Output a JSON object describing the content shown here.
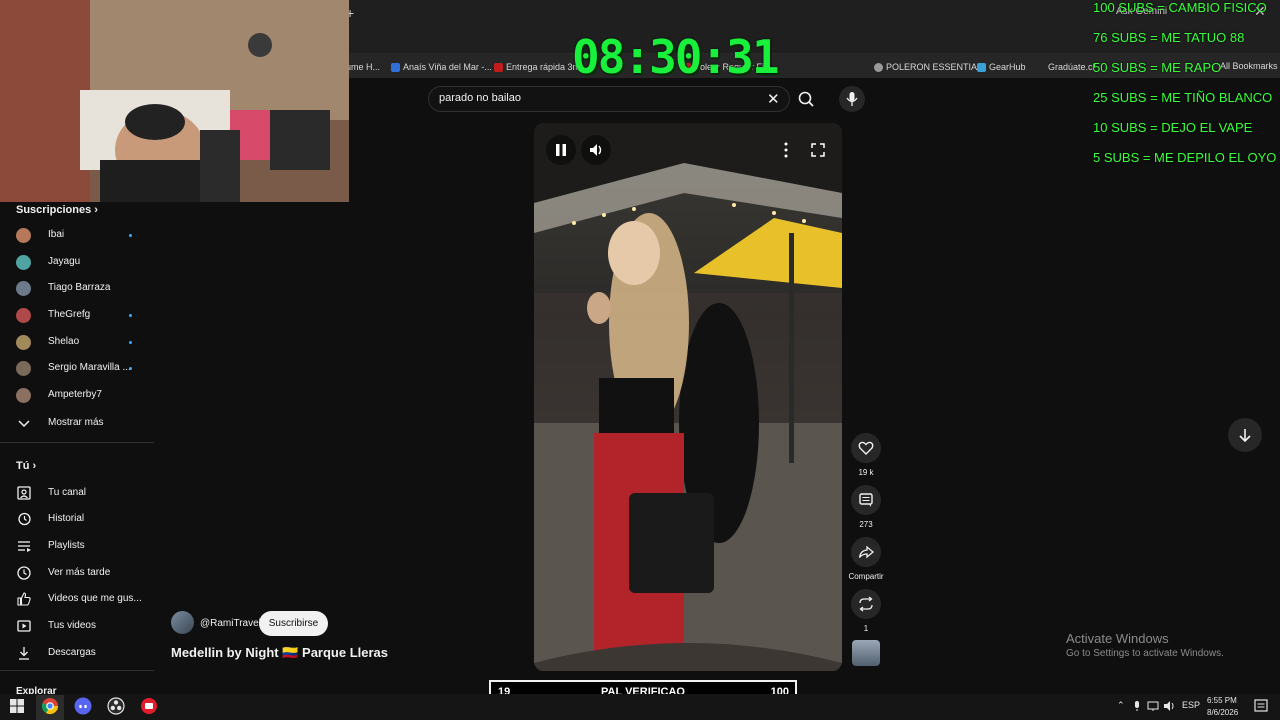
{
  "browser": {
    "ask_gemini": "Ask Gemini",
    "new_tab_glyph": "+",
    "close_glyph": "✕",
    "bookmarks": [
      {
        "label": "ume H...",
        "color": "#1f1f1f"
      },
      {
        "label": "Anaís Viña del Mar -...",
        "color": "#2f6fd6"
      },
      {
        "label": "Entrega rápida 3mi",
        "color": "#c21d1d"
      },
      {
        "label": "Polera Regular Fit -...",
        "color": "#c21d1d"
      },
      {
        "label": "POLERON ESSENTIA...",
        "color": "#9a9a9a"
      },
      {
        "label": "GearHub",
        "color": "#3aa0d8"
      },
      {
        "label": "Gradúate.cl",
        "color": "#1f1f1f"
      }
    ],
    "all_bookmarks": "All Bookmarks"
  },
  "search": {
    "query": "parado no bailao"
  },
  "sidebar": {
    "subscriptions_heading": "Suscripciones",
    "subscriptions": [
      {
        "name": "Ibai",
        "dot": true,
        "color": "#b5785a"
      },
      {
        "name": "Jayagu",
        "dot": false,
        "color": "#4fa3a0"
      },
      {
        "name": "Tiago Barraza",
        "dot": false,
        "color": "#6c7a8a"
      },
      {
        "name": "TheGrefg",
        "dot": true,
        "color": "#b04a4a"
      },
      {
        "name": "Shelao",
        "dot": true,
        "color": "#a08a5a"
      },
      {
        "name": "Sergio Maravilla ...",
        "dot": true,
        "color": "#7a6a5a"
      },
      {
        "name": "Ampeterby7",
        "dot": false,
        "color": "#8a7060"
      }
    ],
    "show_more": "Mostrar más",
    "you_heading": "Tú",
    "you_items": [
      {
        "label": "Tu canal",
        "icon": "channel-icon"
      },
      {
        "label": "Historial",
        "icon": "history-icon"
      },
      {
        "label": "Playlists",
        "icon": "playlists-icon"
      },
      {
        "label": "Ver más tarde",
        "icon": "watch-later-icon"
      },
      {
        "label": "Videos que me gus...",
        "icon": "liked-videos-icon"
      },
      {
        "label": "Tus videos",
        "icon": "your-videos-icon"
      },
      {
        "label": "Descargas",
        "icon": "downloads-icon"
      }
    ],
    "explore_heading": "Explorar"
  },
  "short": {
    "channel_handle": "@RamiTravel",
    "subscribe_label": "Suscribirse",
    "title": "Medellin by Night 🇨🇴 Parque Lleras",
    "likes": "19 k",
    "comments": "273",
    "share": "Compartir",
    "remix": "1"
  },
  "overlay": {
    "timer": "08:30:31",
    "goals": [
      "100 SUBS = CAMBIO FISICO",
      "76 SUBS = ME TATUO 88",
      "50 SUBS = ME RAPO",
      "25 SUBS = ME TIÑO BLANCO",
      "10 SUBS = DEJO EL VAPE",
      "5 SUBS = ME DEPILO EL OYO"
    ],
    "goalbar": {
      "current": "19",
      "label": "PAL VERIFICAO",
      "target": "100"
    }
  },
  "windows": {
    "activate_title": "Activate Windows",
    "activate_sub": "Go to Settings to activate Windows.",
    "lang": "ESP",
    "time": "6:55 PM",
    "date": "8/6/2026"
  }
}
